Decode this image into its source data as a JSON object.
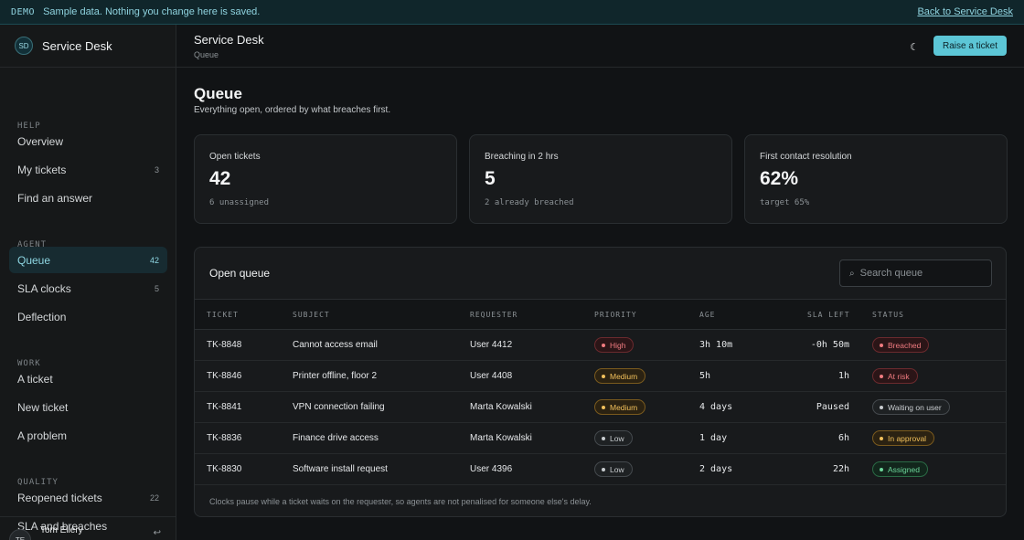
{
  "banner": {
    "tag": "DEMO",
    "message": "Sample data. Nothing you change here is saved.",
    "back_link": "Back to Service Desk"
  },
  "brand": {
    "initials": "SD",
    "name": "Service Desk"
  },
  "sidebar": {
    "sections": [
      {
        "label": "HELP",
        "items": [
          {
            "label": "Overview",
            "count": ""
          },
          {
            "label": "My tickets",
            "count": "3"
          },
          {
            "label": "Find an answer",
            "count": ""
          }
        ]
      },
      {
        "label": "AGENT",
        "items": [
          {
            "label": "Queue",
            "count": "42",
            "active": true
          },
          {
            "label": "SLA clocks",
            "count": "5"
          },
          {
            "label": "Deflection",
            "count": ""
          }
        ]
      },
      {
        "label": "WORK",
        "items": [
          {
            "label": "A ticket",
            "count": ""
          },
          {
            "label": "New ticket",
            "count": ""
          },
          {
            "label": "A problem",
            "count": ""
          }
        ]
      },
      {
        "label": "QUALITY",
        "items": [
          {
            "label": "Reopened tickets",
            "count": "22"
          },
          {
            "label": "SLA and breaches",
            "count": ""
          }
        ]
      }
    ],
    "user": {
      "initials": "TE",
      "name": "Tom Ellery",
      "icon": "sign-out-icon"
    }
  },
  "header": {
    "title": "Service Desk",
    "subtitle": "Queue",
    "theme_icon": "moon-icon",
    "raise_button": "Raise a ticket",
    "accent": "#5cc6d6"
  },
  "page": {
    "title": "Queue",
    "subtitle": "Everything open, ordered by what breaches first."
  },
  "stats": [
    {
      "label": "Open tickets",
      "value": "42",
      "note": "6 unassigned"
    },
    {
      "label": "Breaching in 2 hrs",
      "value": "5",
      "note": "2 already breached"
    },
    {
      "label": "First contact resolution",
      "value": "62%",
      "note": "target 65%"
    }
  ],
  "queue": {
    "title": "Open queue",
    "search_placeholder": "Search queue",
    "columns": [
      "TICKET",
      "SUBJECT",
      "REQUESTER",
      "PRIORITY",
      "AGE",
      "SLA LEFT",
      "STATUS"
    ],
    "rows": [
      {
        "ticket": "TK-8848",
        "subject": "Cannot access email",
        "requester": "User 4412",
        "priority": "High",
        "priority_color": "red",
        "age": "3h 10m",
        "sla_left": "-0h 50m",
        "status": "Breached",
        "status_color": "red"
      },
      {
        "ticket": "TK-8846",
        "subject": "Printer offline, floor 2",
        "requester": "User 4408",
        "priority": "Medium",
        "priority_color": "amber",
        "age": "5h",
        "sla_left": "1h",
        "status": "At risk",
        "status_color": "red"
      },
      {
        "ticket": "TK-8841",
        "subject": "VPN connection failing",
        "requester": "Marta Kowalski",
        "priority": "Medium",
        "priority_color": "amber",
        "age": "4 days",
        "sla_left": "Paused",
        "status": "Waiting on user",
        "status_color": "grey"
      },
      {
        "ticket": "TK-8836",
        "subject": "Finance drive access",
        "requester": "Marta Kowalski",
        "priority": "Low",
        "priority_color": "grey",
        "age": "1 day",
        "sla_left": "6h",
        "status": "In approval",
        "status_color": "amber"
      },
      {
        "ticket": "TK-8830",
        "subject": "Software install request",
        "requester": "User 4396",
        "priority": "Low",
        "priority_color": "grey",
        "age": "2 days",
        "sla_left": "22h",
        "status": "Assigned",
        "status_color": "green"
      }
    ],
    "footnote": "Clocks pause while a ticket waits on the requester, so agents are not penalised for someone else's delay."
  }
}
